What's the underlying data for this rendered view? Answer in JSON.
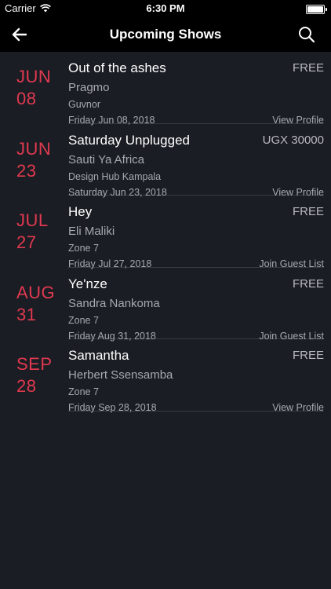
{
  "status_bar": {
    "carrier": "Carrier",
    "time": "6:30 PM",
    "wifi_icon": "wifi-icon",
    "battery_icon": "battery-icon"
  },
  "nav": {
    "title": "Upcoming Shows",
    "back_icon": "arrow-left-icon",
    "search_icon": "search-icon"
  },
  "colors": {
    "background": "#1b1d24",
    "bar": "#000000",
    "accent": "#e0394f",
    "secondary_text": "#a7a9b0",
    "divider": "#3a3c44"
  },
  "shows": [
    {
      "month": "JUN",
      "day": "08",
      "title": "Out of the ashes",
      "price": "FREE",
      "artist": "Pragmo",
      "venue": "Guvnor",
      "date_full": "Friday Jun 08, 2018",
      "action": "View Profile"
    },
    {
      "month": "JUN",
      "day": "23",
      "title": "Saturday Unplugged",
      "price": "UGX 30000",
      "artist": "Sauti Ya Africa",
      "venue": "Design Hub Kampala",
      "date_full": "Saturday Jun 23, 2018",
      "action": "View Profile"
    },
    {
      "month": "JUL",
      "day": "27",
      "title": "Hey",
      "price": "FREE",
      "artist": "Eli Maliki",
      "venue": "Zone 7",
      "date_full": "Friday Jul 27, 2018",
      "action": "Join Guest List"
    },
    {
      "month": "AUG",
      "day": "31",
      "title": "Ye'nze",
      "price": "FREE",
      "artist": "Sandra Nankoma",
      "venue": "Zone 7",
      "date_full": "Friday Aug 31, 2018",
      "action": "Join Guest List"
    },
    {
      "month": "SEP",
      "day": "28",
      "title": "Samantha",
      "price": "FREE",
      "artist": "Herbert Ssensamba",
      "venue": "Zone 7",
      "date_full": "Friday Sep 28, 2018",
      "action": "View Profile"
    }
  ]
}
